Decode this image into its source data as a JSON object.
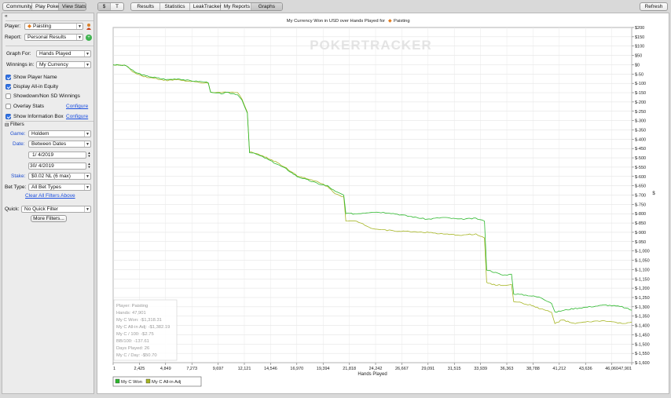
{
  "toolbar": {
    "left_tabs": [
      "Community",
      "Play Poker",
      "View Stats"
    ],
    "active_left": "View Stats",
    "currency_tabs": [
      "$",
      "T"
    ],
    "report_tabs": [
      "Results",
      "Statistics",
      "LeakTracker",
      "My Reports",
      "Graphs"
    ],
    "active_report": "Graphs",
    "refresh_label": "Refresh"
  },
  "panel": {
    "collapse_glyph": "«",
    "player_label": "Player:",
    "player_value": "Paisting",
    "report_label": "Report:",
    "report_value": "Personal Results",
    "graph_for_label": "Graph For:",
    "graph_for_value": "Hands Played",
    "winnings_in_label": "Winnings in:",
    "winnings_in_value": "My Currency",
    "checkboxes": [
      {
        "label": "Show Player Name",
        "checked": true
      },
      {
        "label": "Display All-in Equity",
        "checked": true
      },
      {
        "label": "Showdown/Non SD Winnings",
        "checked": false
      },
      {
        "label": "Overlay Stats",
        "checked": false,
        "link": "Configure"
      },
      {
        "label": "Show Information Box",
        "checked": true,
        "link": "Configure"
      }
    ],
    "filters_header": "Filters",
    "game_label": "Game:",
    "game_value": "Holdem",
    "date_label": "Date:",
    "date_value": "Between Dates",
    "date_from": "1/  4/2019",
    "date_to": "30/  4/2019",
    "stake_label": "Stake:",
    "stake_value": "$0.02 NL (6 max)",
    "bet_type_label": "Bet Type:",
    "bet_type_value": "All Bet Types",
    "clear_filters": "Clear All Filters Above",
    "quick_label": "Quick:",
    "quick_value": "No Quick Filter",
    "more_filters": "More Filters..."
  },
  "chart_data": {
    "type": "line",
    "title": "My Currency Won in USD over Hands Played for",
    "title_player": "Paisting",
    "watermark": "POKERTRACKER",
    "xlabel": "Hands Played",
    "ylabel": "$",
    "xlim": [
      1,
      47901
    ],
    "ylim": [
      -1600,
      200
    ],
    "x_ticks": [
      "1",
      "2,425",
      "4,849",
      "7,273",
      "9,697",
      "12,121",
      "14,546",
      "16,970",
      "19,394",
      "21,818",
      "24,242",
      "26,667",
      "29,091",
      "31,515",
      "33,939",
      "36,363",
      "38,788",
      "41,212",
      "43,636",
      "46,060",
      "47,901"
    ],
    "x_tick_values": [
      1,
      2425,
      4849,
      7273,
      9697,
      12121,
      14546,
      16970,
      19394,
      21818,
      24242,
      26667,
      29091,
      31515,
      33939,
      36363,
      38788,
      41212,
      43636,
      46060,
      47901
    ],
    "y_ticks": [
      200,
      150,
      100,
      50,
      0,
      -50,
      -100,
      -150,
      -200,
      -250,
      -300,
      -350,
      -400,
      -450,
      -500,
      -550,
      -600,
      -650,
      -700,
      -750,
      -800,
      -850,
      -900,
      -950,
      -1000,
      -1050,
      -1100,
      -1150,
      -1200,
      -1250,
      -1300,
      -1350,
      -1400,
      -1450,
      -1500,
      -1550,
      -1600
    ],
    "y_tick_labels": [
      "$200",
      "$150",
      "$100",
      "$50",
      "$0",
      "$-50",
      "$-100",
      "$-150",
      "$-200",
      "$-250",
      "$-300",
      "$-350",
      "$-400",
      "$-450",
      "$-500",
      "$-550",
      "$-600",
      "$-650",
      "$-700",
      "$-750",
      "$-800",
      "$-850",
      "$-900",
      "$-950",
      "$-1,000",
      "$-1,050",
      "$-1,100",
      "$-1,150",
      "$-1,200",
      "$-1,250",
      "$-1,300",
      "$-1,350",
      "$-1,400",
      "$-1,450",
      "$-1,500",
      "$-1,550",
      "$-1,600"
    ],
    "grid": true,
    "legend_position": "bottom-left",
    "series": [
      {
        "name": "My C Won",
        "color": "#2db82d",
        "x": [
          1,
          1200,
          2000,
          3000,
          4000,
          5000,
          6000,
          7000,
          8000,
          8800,
          9000,
          10000,
          10500,
          11500,
          11900,
          12400,
          12600,
          13200,
          14000,
          15000,
          16000,
          17000,
          18000,
          19000,
          19800,
          20500,
          21300,
          21500,
          22500,
          24000,
          25500,
          27000,
          29000,
          30500,
          32000,
          33500,
          34300,
          34500,
          35000,
          36000,
          36800,
          37000,
          38500,
          39500,
          40500,
          40800,
          41500,
          42500,
          44000,
          45500,
          47000,
          47901
        ],
        "values": [
          0,
          -5,
          -40,
          -60,
          -70,
          -80,
          -75,
          -85,
          -90,
          -95,
          -150,
          -155,
          -150,
          -160,
          -190,
          -260,
          -470,
          -480,
          -500,
          -530,
          -560,
          -600,
          -620,
          -640,
          -650,
          -680,
          -700,
          -800,
          -800,
          -790,
          -795,
          -810,
          -830,
          -820,
          -830,
          -825,
          -840,
          -1100,
          -1110,
          -1130,
          -1125,
          -1230,
          -1240,
          -1250,
          -1280,
          -1330,
          -1320,
          -1310,
          -1300,
          -1290,
          -1300,
          -1318
        ]
      },
      {
        "name": "My C All-in Adj",
        "color": "#a6b523",
        "x": [
          1,
          1200,
          2000,
          3000,
          4000,
          5000,
          6000,
          7000,
          8000,
          8800,
          9000,
          10000,
          10500,
          11500,
          11900,
          12400,
          12600,
          13200,
          14000,
          15000,
          16000,
          17000,
          18000,
          19000,
          19800,
          20500,
          21300,
          21500,
          22500,
          24000,
          25500,
          27000,
          29000,
          30500,
          32000,
          33500,
          34300,
          34500,
          35000,
          36000,
          36800,
          37000,
          38500,
          39500,
          40500,
          40800,
          41500,
          42500,
          44000,
          45500,
          47000,
          47901
        ],
        "values": [
          0,
          -5,
          -45,
          -65,
          -75,
          -85,
          -80,
          -90,
          -95,
          -100,
          -150,
          -150,
          -145,
          -150,
          -185,
          -255,
          -465,
          -475,
          -495,
          -520,
          -555,
          -595,
          -615,
          -630,
          -655,
          -690,
          -710,
          -840,
          -840,
          -880,
          -890,
          -895,
          -900,
          -910,
          -915,
          -910,
          -930,
          -1170,
          -1180,
          -1185,
          -1180,
          -1270,
          -1290,
          -1310,
          -1330,
          -1390,
          -1370,
          -1390,
          -1380,
          -1375,
          -1390,
          -1382
        ]
      }
    ]
  },
  "info_box": {
    "lines": [
      "Player: Paisting",
      "Hands: 47,901",
      "My C Won: -$1,318.31",
      "My C All-in Adj: -$1,382.19",
      "My C / 100: -$2.75",
      "BB/100: -137.61",
      "Days Played: 26",
      "My C / Day: -$50.70"
    ]
  }
}
